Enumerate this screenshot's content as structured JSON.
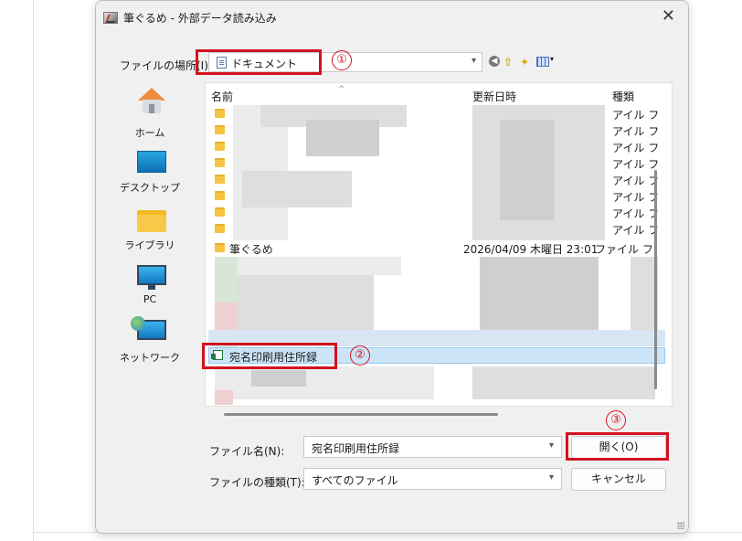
{
  "window": {
    "title": "筆ぐるめ - 外部データ読み込み",
    "close": "✕"
  },
  "location": {
    "label": "ファイルの場所(I):",
    "value": "ドキュメント"
  },
  "toolbar": {
    "back": "◀",
    "up": "⇧",
    "new_folder": "📂",
    "view_arrow": "▾"
  },
  "places": [
    {
      "label": "ホーム",
      "icon": "home-icon"
    },
    {
      "label": "デスクトップ",
      "icon": "desktop-icon"
    },
    {
      "label": "ライブラリ",
      "icon": "library-icon"
    },
    {
      "label": "PC",
      "icon": "pc-icon"
    },
    {
      "label": "ネットワーク",
      "icon": "network-icon"
    }
  ],
  "columns": {
    "name": "名前",
    "modified": "更新日時",
    "type": "種類"
  },
  "type_fragment": "アイル フ",
  "rows": {
    "fudegurume": {
      "name": "筆ぐるめ",
      "date": "2026/04/09 木曜日 23:01",
      "type": "ファイル フ"
    },
    "selected": {
      "name": "宛名印刷用住所録"
    }
  },
  "filename": {
    "label": "ファイル名(N):",
    "value": "宛名印刷用住所録"
  },
  "filetype": {
    "label": "ファイルの種類(T):",
    "value": "すべてのファイル"
  },
  "buttons": {
    "open": "開く(O)",
    "cancel": "キャンセル"
  },
  "annotations": {
    "step1": "①",
    "step2": "②",
    "step3": "③"
  },
  "colors": {
    "callout": "#d3121f",
    "selection": "#cce4f7",
    "folder": "#f5c542"
  }
}
